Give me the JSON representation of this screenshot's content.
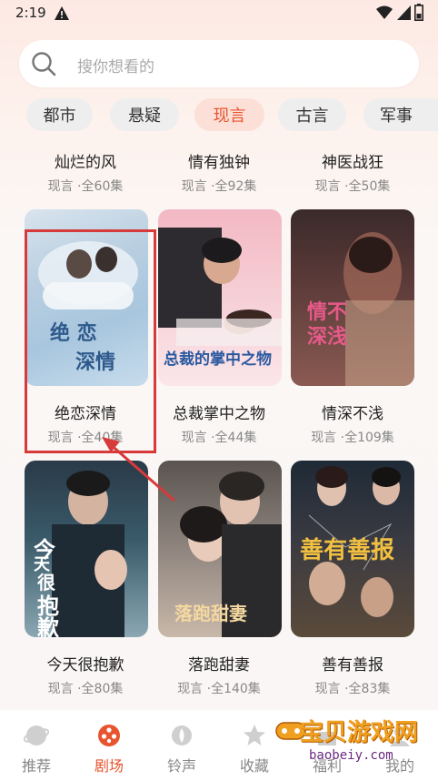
{
  "status_bar": {
    "time": "2:19"
  },
  "search": {
    "placeholder": "搜你想看的"
  },
  "categories": [
    {
      "label": "都市",
      "active": false
    },
    {
      "label": "悬疑",
      "active": false
    },
    {
      "label": "现言",
      "active": true
    },
    {
      "label": "古言",
      "active": false
    },
    {
      "label": "军事",
      "active": false
    }
  ],
  "row0": [
    {
      "title": "灿烂的风",
      "meta": "现言 ·全60集"
    },
    {
      "title": "情有独钟",
      "meta": "现言 ·全92集"
    },
    {
      "title": "神医战狂",
      "meta": "现言 ·全50集"
    }
  ],
  "row1": [
    {
      "title": "绝恋深情",
      "meta": "现言 ·全40集",
      "poster_text": [
        "绝 恋",
        "深情"
      ]
    },
    {
      "title": "总裁掌中之物",
      "meta": "现言 ·全44集",
      "poster_text": [
        "总裁的掌中之物"
      ]
    },
    {
      "title": "情深不浅",
      "meta": "现言 ·全109集",
      "poster_text": [
        "情不",
        "深浅"
      ]
    }
  ],
  "row2": [
    {
      "title": "今天很抱歉",
      "meta": "现言 ·全80集",
      "poster_text": [
        "今",
        "天",
        "很",
        "抱",
        "歉"
      ]
    },
    {
      "title": "落跑甜妻",
      "meta": "现言 ·全140集",
      "poster_text": [
        "落跑甜妻"
      ]
    },
    {
      "title": "善有善报",
      "meta": "现言 ·全83集",
      "poster_text": [
        "善有善报"
      ]
    }
  ],
  "bottom_nav": [
    {
      "label": "推荐",
      "icon": "recommend-icon",
      "active": false
    },
    {
      "label": "剧场",
      "icon": "theater-icon",
      "active": true
    },
    {
      "label": "铃声",
      "icon": "ringtone-icon",
      "active": false
    },
    {
      "label": "收藏",
      "icon": "favorite-icon",
      "active": false
    },
    {
      "label": "福利",
      "icon": "gift-icon",
      "active": false
    },
    {
      "label": "我的",
      "icon": "profile-icon",
      "active": false
    }
  ],
  "watermark": {
    "main": "宝贝游戏网",
    "url": "baobeiy.com"
  },
  "colors": {
    "accent": "#e8542e",
    "highlight": "#d63a3a"
  }
}
